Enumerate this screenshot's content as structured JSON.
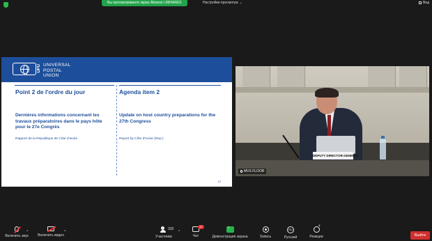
{
  "top_bar": {
    "share_banner": "Вы просматриваете экран Alkansir LIMHARES",
    "view_options": "Настройки просмотра",
    "view_mode": "Вид",
    "shield_icon": "shield-icon",
    "accent_color": "#23a34b"
  },
  "slide": {
    "org_abbr": "UPU",
    "org_name": [
      "UNIVERSAL",
      "POSTAL",
      "UNION"
    ],
    "header_color": "#1d4e9b",
    "left": {
      "title": "Point 2 de l'ordre du jour",
      "body": "Dernières informations concernant les travaux préparatoires dans le pays hôte pour le 27e Congrès",
      "source": "Rapport de la République de Côte d'Ivoire"
    },
    "right": {
      "title": "Agenda item 2",
      "body": "Update on host country preparations for the 27th Congress",
      "source": "Report by Côte d'Ivoire (Rep.)"
    },
    "page_number": "12"
  },
  "video": {
    "nameplate": "DEPUTY DIRECTOR-GENERAL",
    "participant_name": "MVS FLOOR"
  },
  "toolbar": {
    "items": [
      {
        "label": "Включить звук",
        "icon": "microphone-muted-icon"
      },
      {
        "label": "Включить видео",
        "icon": "video-off-icon"
      },
      {
        "label": "Участники",
        "icon": "participants-icon",
        "count": "326"
      },
      {
        "label": "Чат",
        "icon": "chat-icon",
        "badge": "17"
      },
      {
        "label": "Демонстрация экрана",
        "icon": "share-screen-icon"
      },
      {
        "label": "Запись",
        "icon": "record-icon"
      },
      {
        "label": "Русский",
        "icon": "language-icon",
        "icon_text": "RU"
      },
      {
        "label": "Реакции",
        "icon": "reactions-icon"
      }
    ],
    "leave_label": "Выйти",
    "leave_color": "#d32f2f"
  }
}
